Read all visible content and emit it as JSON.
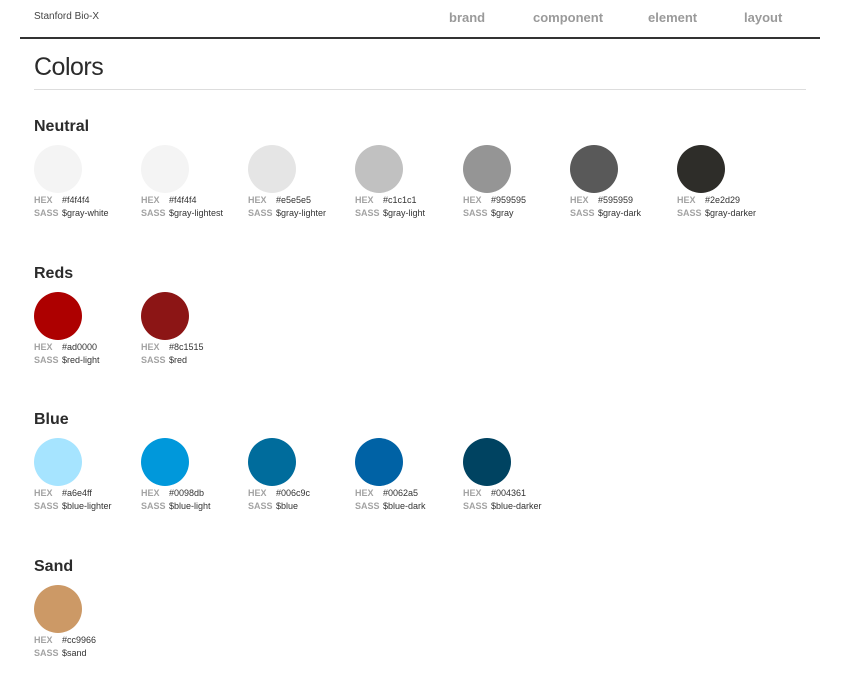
{
  "header": {
    "site_name": "Stanford Bio-X",
    "nav": [
      "brand",
      "component",
      "element",
      "layout"
    ]
  },
  "page": {
    "title": "Colors"
  },
  "labels": {
    "hex": "HEX",
    "sass": "SASS"
  },
  "sections": [
    {
      "heading": "Neutral",
      "swatches": [
        {
          "hex": "#f4f4f4",
          "sass": "$gray-white"
        },
        {
          "hex": "#f4f4f4",
          "sass": "$gray-lightest"
        },
        {
          "hex": "#e5e5e5",
          "sass": "$gray-lighter"
        },
        {
          "hex": "#c1c1c1",
          "sass": "$gray-light"
        },
        {
          "hex": "#959595",
          "sass": "$gray"
        },
        {
          "hex": "#595959",
          "sass": "$gray-dark"
        },
        {
          "hex": "#2e2d29",
          "sass": "$gray-darker"
        }
      ]
    },
    {
      "heading": "Reds",
      "swatches": [
        {
          "hex": "#ad0000",
          "sass": "$red-light"
        },
        {
          "hex": "#8c1515",
          "sass": "$red"
        }
      ]
    },
    {
      "heading": "Blue",
      "swatches": [
        {
          "hex": "#a6e4ff",
          "sass": "$blue-lighter"
        },
        {
          "hex": "#0098db",
          "sass": "$blue-light"
        },
        {
          "hex": "#006c9c",
          "sass": "$blue"
        },
        {
          "hex": "#0062a5",
          "sass": "$blue-dark"
        },
        {
          "hex": "#004361",
          "sass": "$blue-darker"
        }
      ]
    },
    {
      "heading": "Sand",
      "swatches": [
        {
          "hex": "#cc9966",
          "sass": "$sand"
        }
      ]
    }
  ]
}
